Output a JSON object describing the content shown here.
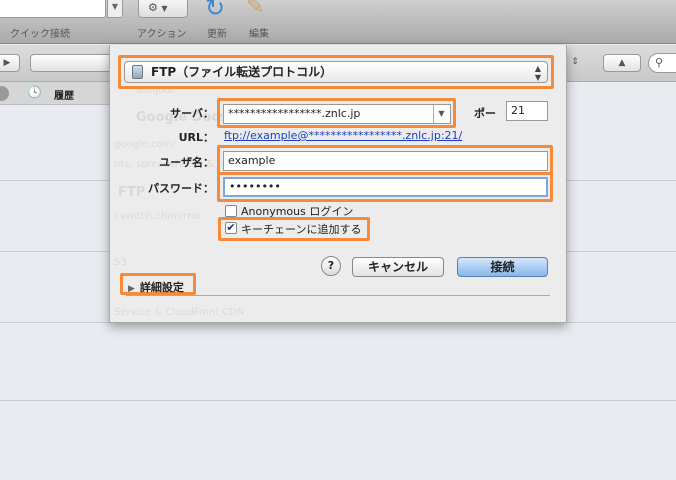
{
  "toolbar": {
    "quick_connect_label": "クイック接続",
    "action_label": "アクション",
    "refresh_label": "更新",
    "edit_label": "編集"
  },
  "sidebar": {
    "history_label": "履歴"
  },
  "background_faint": [
    "Bonjour",
    "Google Docs",
    "google.com/",
    "nts, spreadsheets & pr",
    "FTP",
    "r.switch.ch/mirror",
    "S3",
    "Service & CloudFront CDN"
  ],
  "dialog": {
    "protocol": "FTP（ファイル転送プロトコル）",
    "server_label": "サーバ：",
    "server_value": "*****************.znlc.jp",
    "port_label": "ポー",
    "port_value": "21",
    "url_label": "URL：",
    "url_value": "ftp://example@*****************.znlc.jp:21/",
    "username_label": "ユーザ名：",
    "username_value": "example",
    "password_label": "パスワード：",
    "password_value": "••••••••",
    "anonymous_label": "Anonymous ログイン",
    "anonymous_checked": false,
    "keychain_label": "キーチェーンに追加する",
    "keychain_checked": true,
    "help_label": "?",
    "cancel_label": "キャンセル",
    "connect_label": "接続",
    "advanced_label": "詳細設定"
  },
  "colors": {
    "highlight": "#f58b3a",
    "link": "#1a3fc4",
    "default_button": "#89b6ea"
  }
}
